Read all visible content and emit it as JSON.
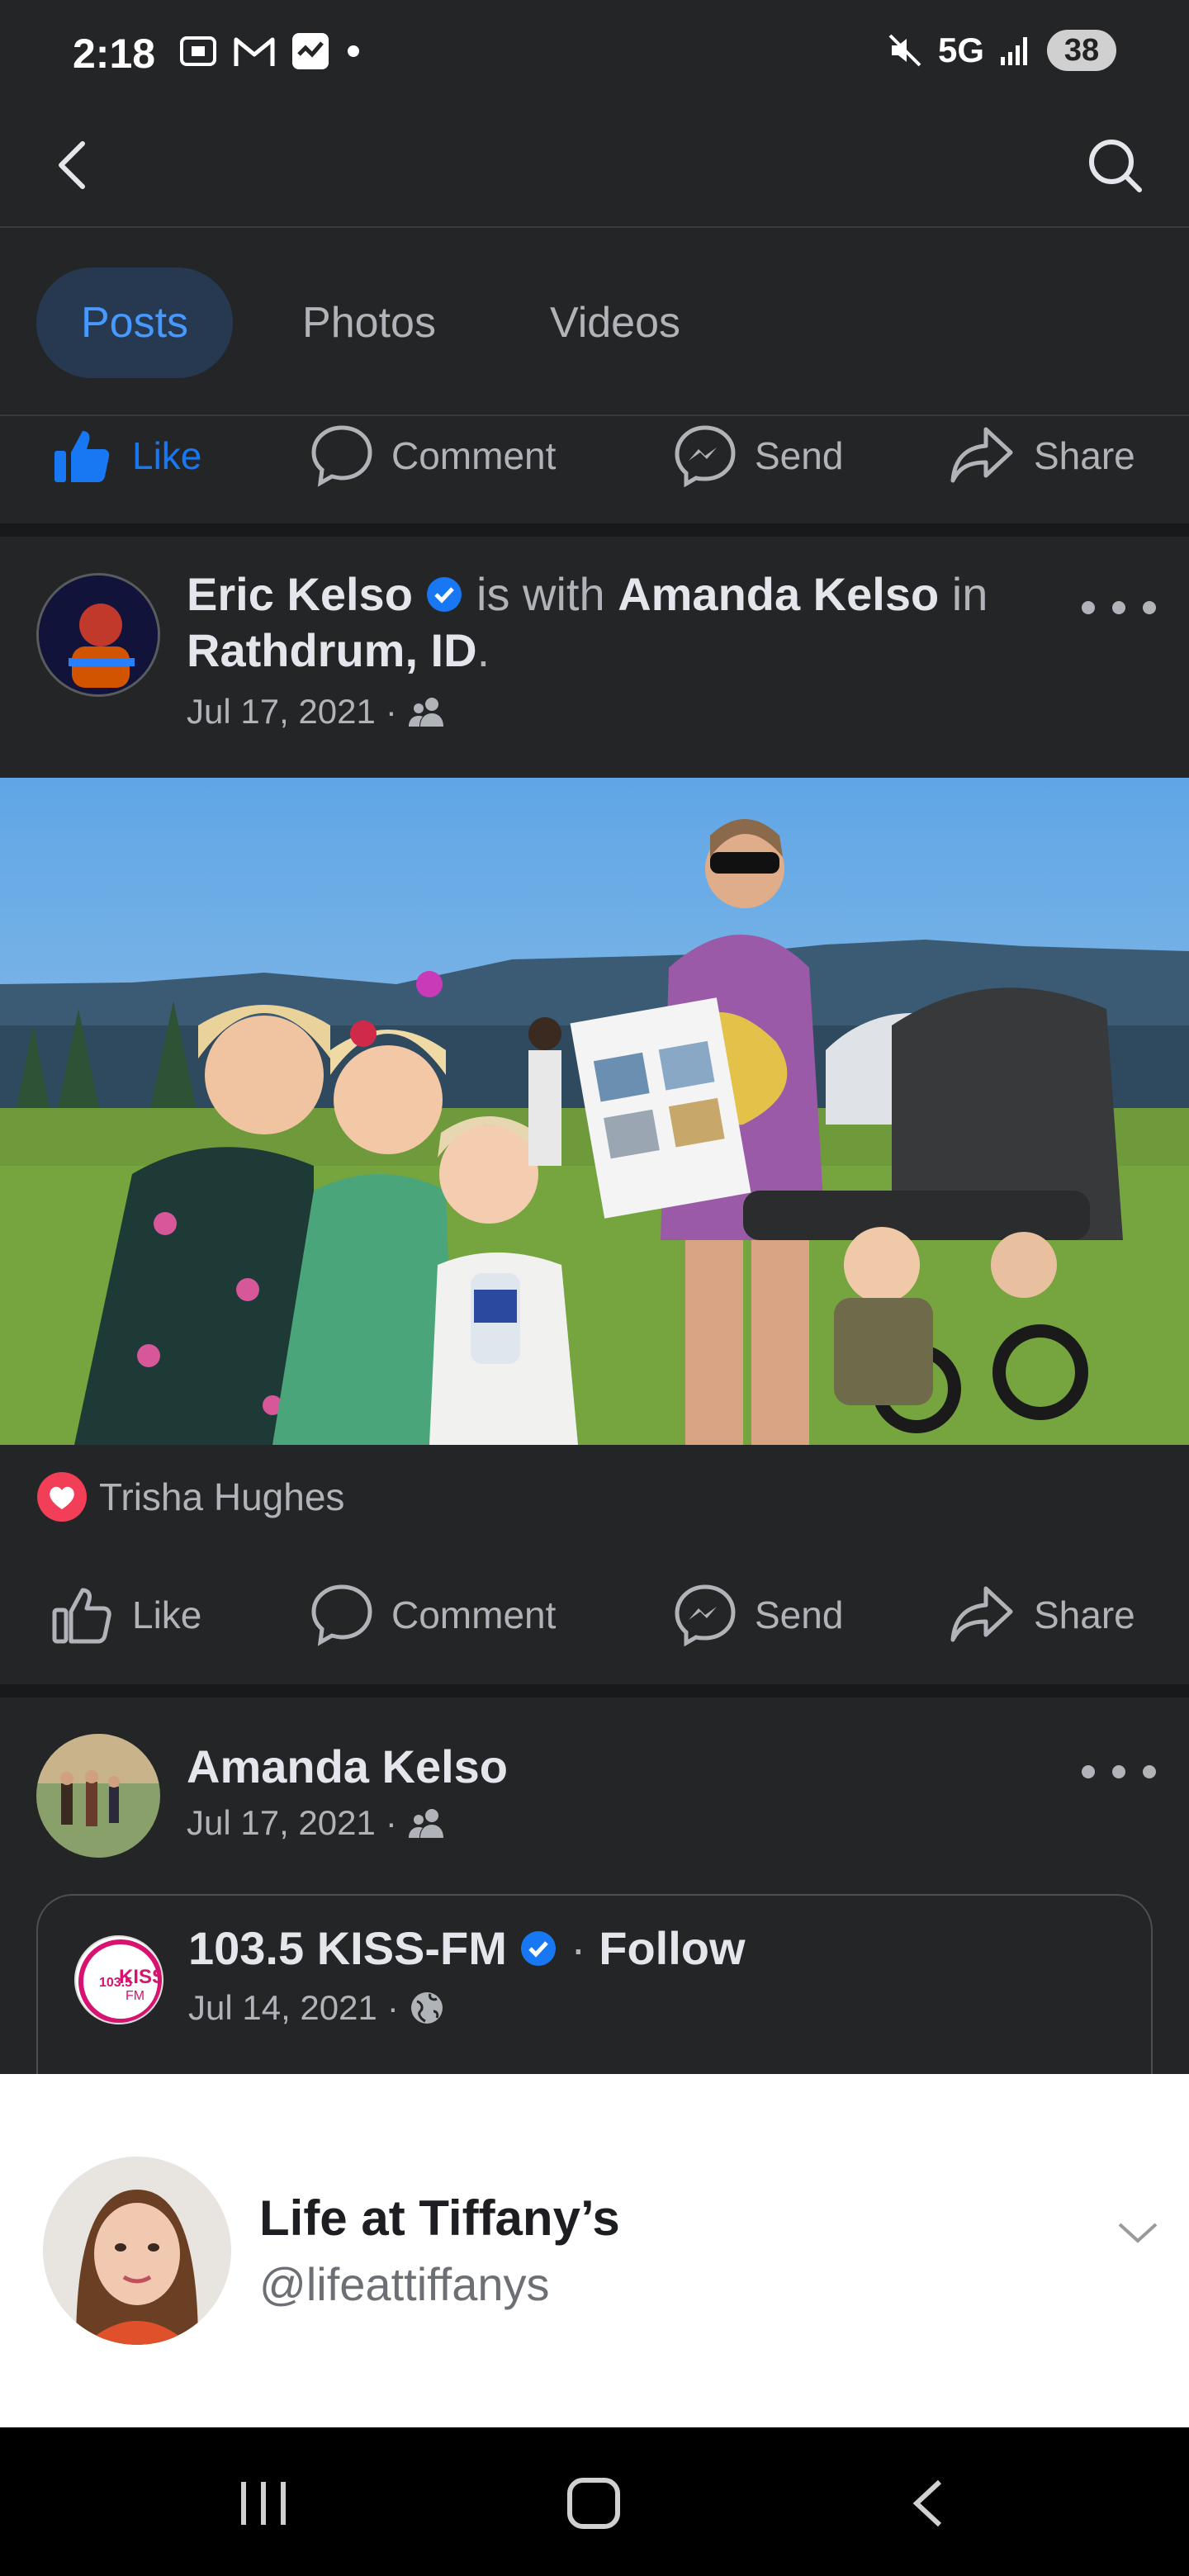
{
  "status_bar": {
    "time": "2:18",
    "network": "5G",
    "battery": "38"
  },
  "topbar": {
    "back_icon": "back-arrow-icon",
    "search_icon": "search-icon"
  },
  "tabs": [
    {
      "label": "Posts",
      "active": true
    },
    {
      "label": "Photos",
      "active": false
    },
    {
      "label": "Videos",
      "active": false
    }
  ],
  "top_actions": {
    "like": "Like",
    "comment": "Comment",
    "send": "Send",
    "share": "Share"
  },
  "post1": {
    "author": "Eric Kelso",
    "with_text": "is with",
    "tagged": "Amanda Kelso",
    "in_text": "in",
    "location": "Rathdrum, ID",
    "period": ".",
    "date": "Jul 17, 2021",
    "sep": "·",
    "reaction_by": "Trisha Hughes",
    "actions": {
      "like": "Like",
      "comment": "Comment",
      "send": "Send",
      "share": "Share"
    }
  },
  "post2": {
    "author": "Amanda Kelso",
    "date": "Jul 17, 2021",
    "sep": "·",
    "shared": {
      "page_name": "103.5 KISS-FM",
      "sep": "·",
      "follow": "Follow",
      "date": "Jul 14, 2021",
      "logo_text_top": "103.5",
      "logo_text_main": "KISS",
      "logo_text_bottom": "FM"
    }
  },
  "ad_banner": {
    "name": "Life at Tiffany’s",
    "handle": "@lifeattiffanys"
  },
  "colors": {
    "background": "#242526",
    "accent": "#1877f2",
    "link": "#4599ff",
    "text_secondary": "#b0b3b8",
    "love_reaction": "#f33e58"
  }
}
